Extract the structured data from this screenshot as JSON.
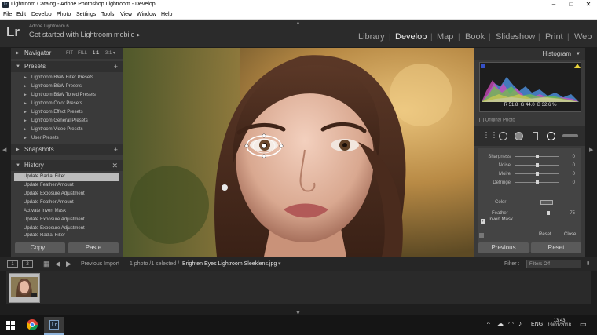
{
  "window": {
    "title": "Lightroom Catalog - Adobe Photoshop Lightroom - Develop",
    "controls": {
      "minimize": "‒",
      "maximize": "□",
      "close": "✕"
    }
  },
  "menu": [
    "File",
    "Edit",
    "Develop",
    "Photo",
    "Settings",
    "Tools",
    "View",
    "Window",
    "Help"
  ],
  "identity": {
    "logo": "Lr",
    "version": "Adobe Lightroom 6",
    "mobile_prompt": "Get started with Lightroom mobile ▸"
  },
  "modules": [
    "Library",
    "Develop",
    "Map",
    "Book",
    "Slideshow",
    "Print",
    "Web"
  ],
  "active_module": "Develop",
  "left_panel": {
    "navigator": {
      "label": "Navigator",
      "zoom": [
        "FIT",
        "FILL",
        "1:1",
        "3:1 ▾"
      ]
    },
    "presets": {
      "label": "Presets",
      "items": [
        "Lightroom B&W Filter Presets",
        "Lightroom B&W Presets",
        "Lightroom B&W Toned Presets",
        "Lightroom Color Presets",
        "Lightroom Effect Presets",
        "Lightroom General Presets",
        "Lightroom Video Presets",
        "User Presets"
      ]
    },
    "snapshots": {
      "label": "Snapshots"
    },
    "history": {
      "label": "History",
      "items": [
        "Update Radial Filter",
        "Update Feather Amount",
        "Update Exposure Adjustment",
        "Update Feather Amount",
        "Activate Invert Mask",
        "Update Exposure Adjustment",
        "Update Exposure Adjustment",
        "Update Radial Filter"
      ],
      "selected_index": 0
    },
    "buttons": {
      "copy": "Copy...",
      "paste": "Paste"
    }
  },
  "right_panel": {
    "histogram": {
      "label": "Histogram",
      "r_label": "R",
      "r": "51.8",
      "g_label": "G",
      "g": "44.0",
      "b_label": "B",
      "b": "32.6",
      "unit": "%",
      "original_photo": "Original Photo"
    },
    "mask_sliders": [
      {
        "label": "Sharpness",
        "value": "0",
        "level": 0.5
      },
      {
        "label": "Noise",
        "value": "0",
        "level": 0.5
      },
      {
        "label": "Moire",
        "value": "0",
        "level": 0.5
      },
      {
        "label": "Defringe",
        "value": "0",
        "level": 0.5
      }
    ],
    "color_label": "Color",
    "feather": {
      "label": "Feather",
      "value": "75",
      "level": 0.75
    },
    "invert_mask": {
      "label": "Invert Mask",
      "checked": "✓"
    },
    "reset_label": "Reset",
    "close_label": "Close",
    "buttons": {
      "previous": "Previous",
      "reset": "Reset"
    }
  },
  "filmstrip_bar": {
    "tag1": "1",
    "tag2": "2",
    "previous_import": "Previous Import",
    "status": "1 photo /1 selected /",
    "filename": "Brighten Eyes Lightroom Sleeklens.jpg",
    "filter_label": "Filter :",
    "filter_value": "Filters Off"
  },
  "taskbar": {
    "lang": "ENG",
    "time": "13:43",
    "date": "19/01/2018"
  }
}
